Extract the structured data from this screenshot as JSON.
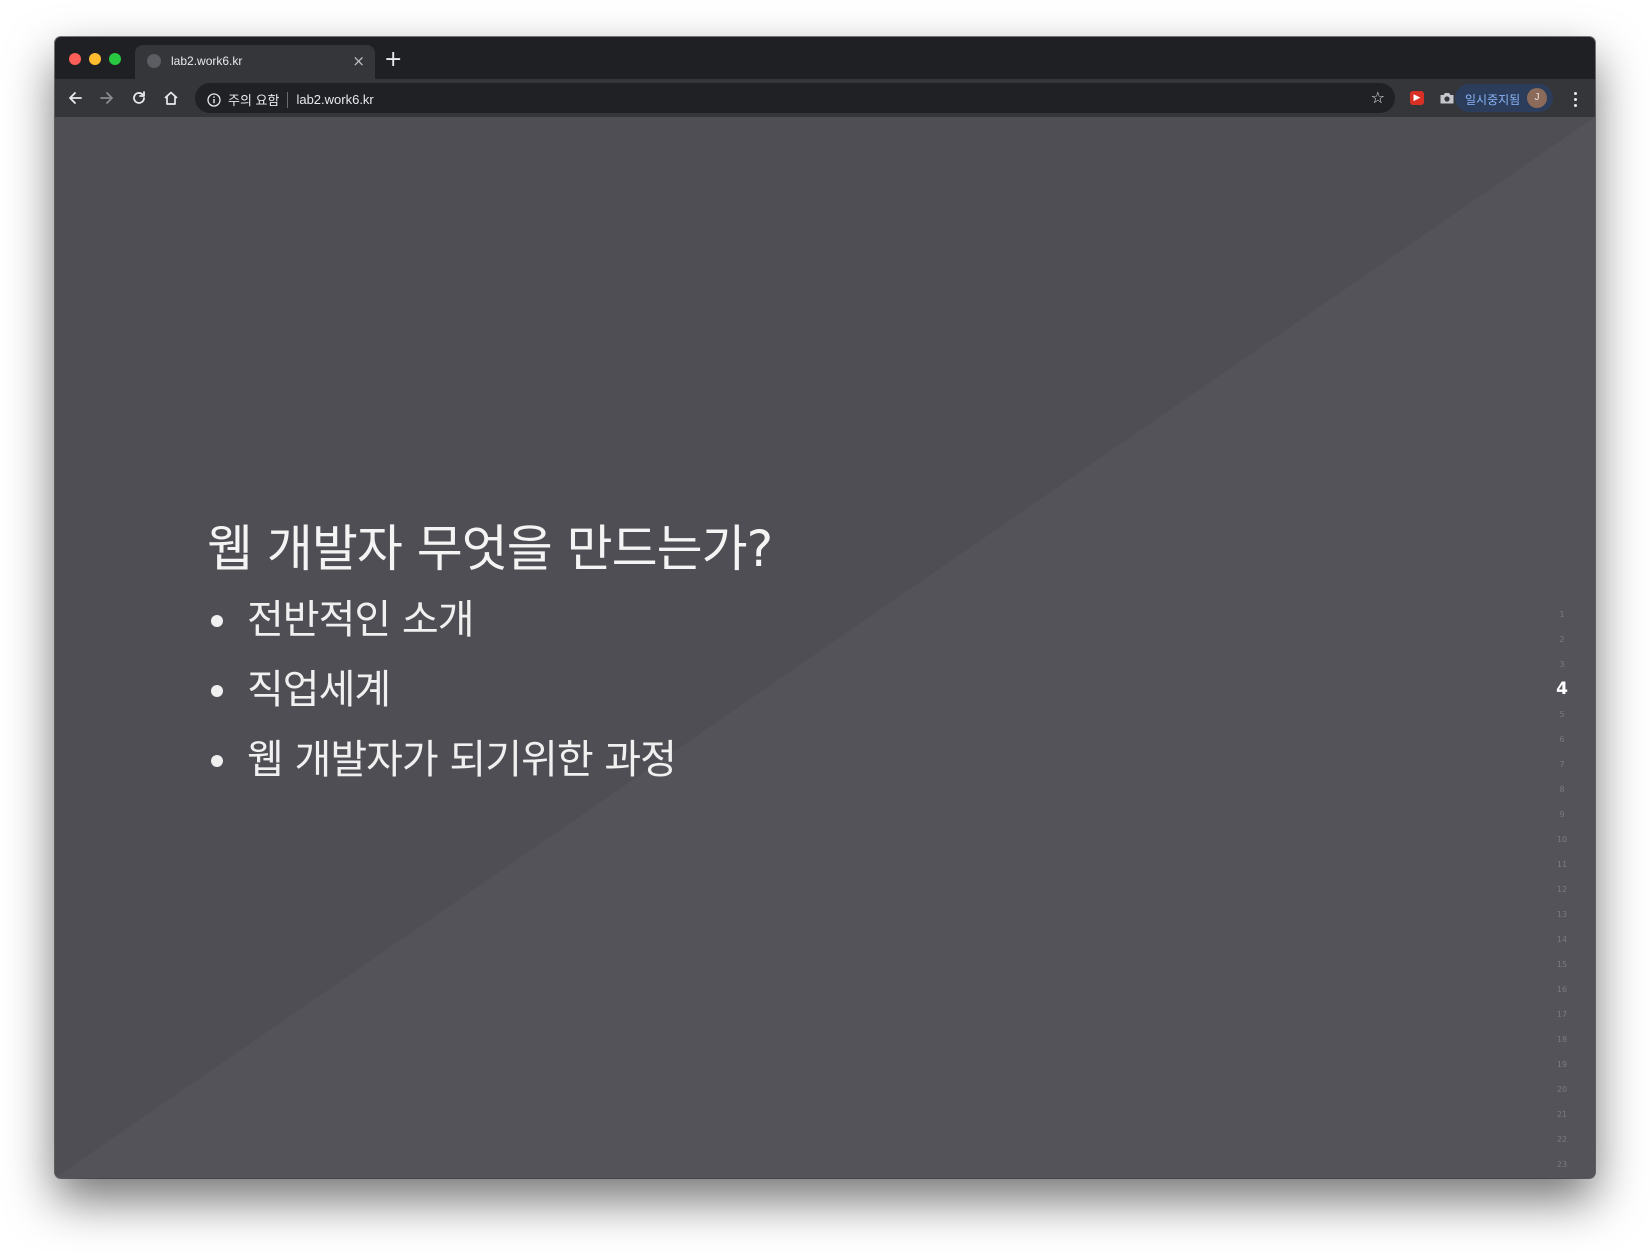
{
  "browser": {
    "tab": {
      "title": "lab2.work6.kr",
      "close": "×"
    },
    "new_tab": "+",
    "security_label": "주의 요함",
    "url": "lab2.work6.kr",
    "profile": {
      "label": "일시중지됨",
      "avatar_initial": "J"
    }
  },
  "slide": {
    "title": "웹 개발자 무엇을 만드는가?",
    "bullets": [
      "전반적인 소개",
      "직업세계",
      "웹 개발자가 되기위한 과정"
    ]
  },
  "pagination": {
    "pages": [
      "1",
      "2",
      "3",
      "4",
      "5",
      "6",
      "7",
      "8",
      "9",
      "10",
      "11",
      "12",
      "13",
      "14",
      "15",
      "16",
      "17",
      "18",
      "19",
      "20",
      "21",
      "22",
      "23"
    ],
    "current": "4"
  }
}
